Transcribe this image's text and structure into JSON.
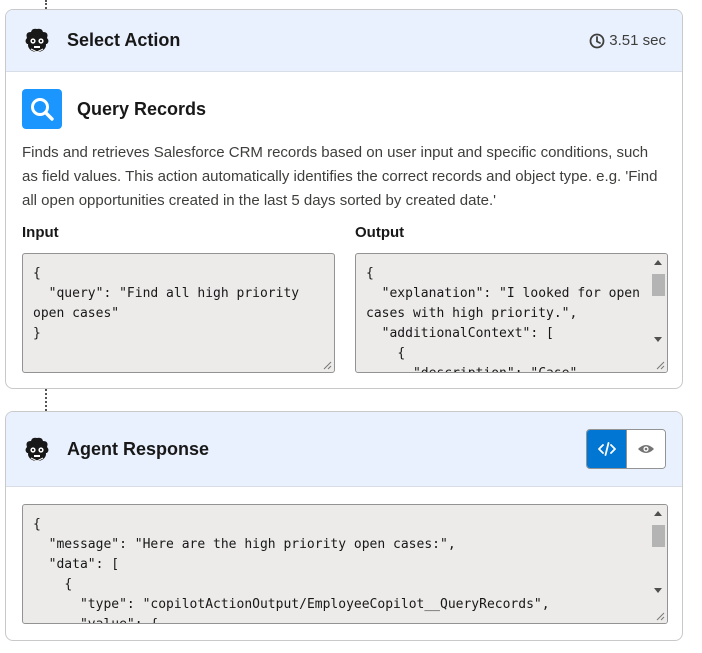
{
  "select_action": {
    "title": "Select Action",
    "duration": "3.51 sec",
    "action": {
      "name": "Query Records",
      "icon": "search-icon",
      "description": "Finds and retrieves Salesforce CRM records based on user input and specific conditions, such as field values. This action automatically identifies the correct records and object type. e.g. 'Find all open opportunities created in the last 5 days sorted by created date.'"
    },
    "input_label": "Input",
    "output_label": "Output",
    "input_json": "{\n  \"query\": \"Find all high priority open cases\"\n}",
    "output_json": "{\n  \"explanation\": \"I looked for open cases with high priority.\",\n  \"additionalContext\": [\n    {\n      \"description\": \"Case\","
  },
  "agent_response": {
    "title": "Agent Response",
    "view_code_icon": "code-icon",
    "view_preview_icon": "eye-icon",
    "response_json": "{\n  \"message\": \"Here are the high priority open cases:\",\n  \"data\": [\n    {\n      \"type\": \"copilotActionOutput/EmployeeCopilot__QueryRecords\",\n      \"value\": {"
  },
  "colors": {
    "header_bg": "#eaf1fe",
    "accent": "#0176d3",
    "search_tile": "#1b96ff",
    "code_bg": "#ecebea"
  }
}
